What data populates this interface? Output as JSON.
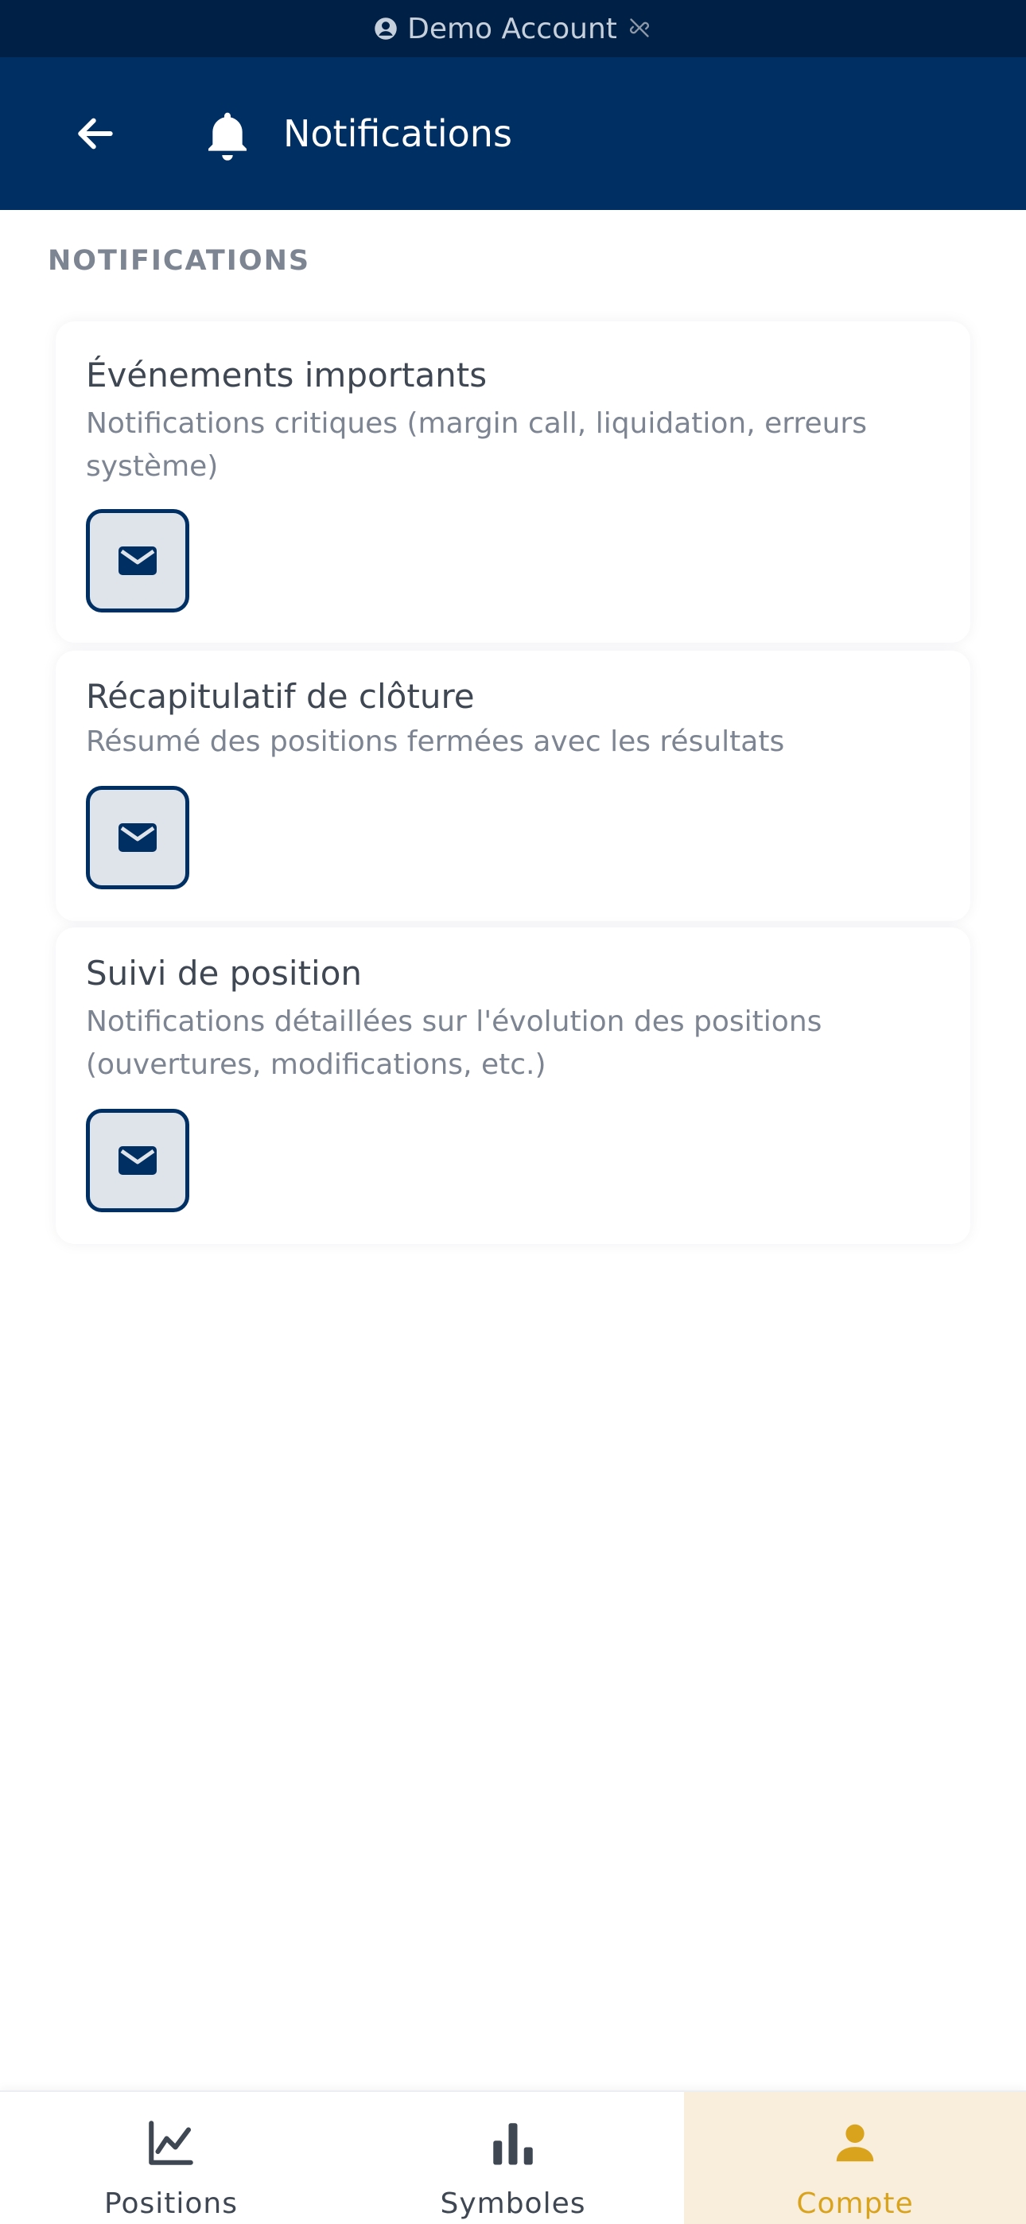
{
  "status_bar": {
    "account_label": "Demo Account",
    "account_icon": "account-circle-icon",
    "connection_icon": "link-off-icon"
  },
  "header": {
    "title": "Notifications",
    "back_icon": "arrow-left-icon",
    "title_icon": "bell-icon"
  },
  "section": {
    "label": "NOTIFICATIONS"
  },
  "cards": [
    {
      "title": "Événements importants",
      "description": "Notifications critiques (margin call, liquidation, erreurs système)",
      "channel_icon": "mail-icon"
    },
    {
      "title": "Récapitulatif de clôture",
      "description": "Résumé des positions fermées avec les résultats",
      "channel_icon": "mail-icon"
    },
    {
      "title": "Suivi de position",
      "description": "Notifications détaillées sur l'évolution des positions (ouvertures, modifications, etc.)",
      "channel_icon": "mail-icon"
    }
  ],
  "bottom_nav": {
    "items": [
      {
        "label": "Positions",
        "icon": "line-chart-icon",
        "active": false
      },
      {
        "label": "Symboles",
        "icon": "bar-chart-icon",
        "active": false
      },
      {
        "label": "Compte",
        "icon": "person-icon",
        "active": true
      }
    ]
  },
  "colors": {
    "header_bg": "#003063",
    "status_bg": "#002145",
    "accent": "#d9a31e",
    "active_nav_bg": "#f9eedb",
    "toggle_border": "#003063",
    "toggle_bg": "#dfe4eb"
  }
}
